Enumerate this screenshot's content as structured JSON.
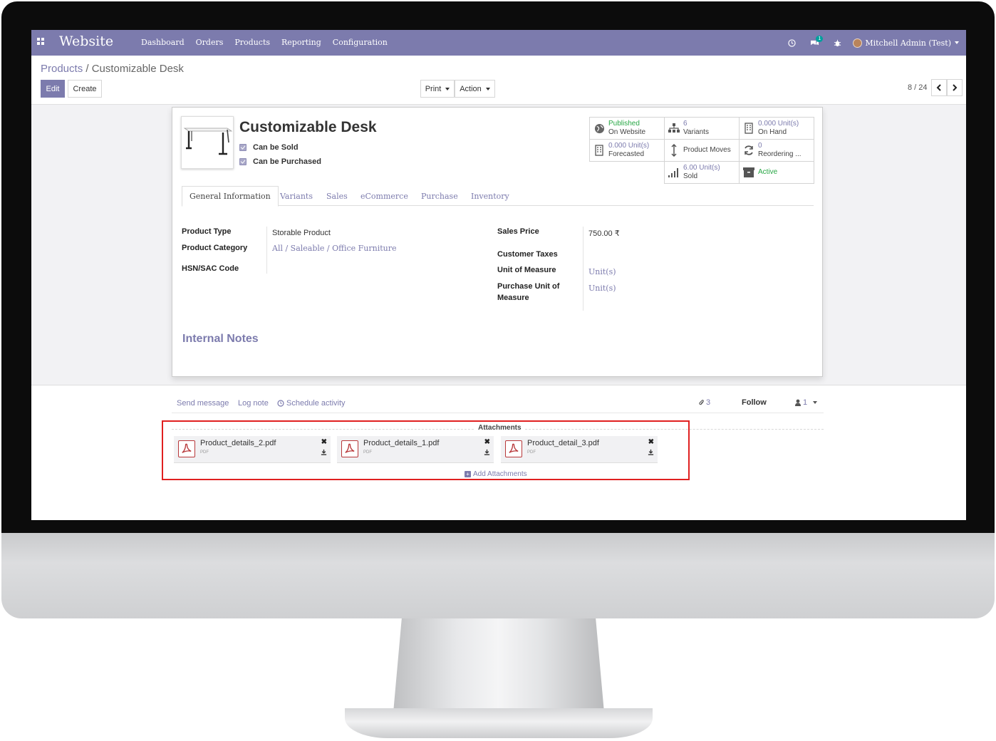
{
  "navbar": {
    "app_title": "Website",
    "menu": [
      "Dashboard",
      "Orders",
      "Products",
      "Reporting",
      "Configuration"
    ],
    "chat_badge": "1",
    "user_name": "Mitchell Admin (Test)"
  },
  "breadcrumb": {
    "parent": "Products",
    "separator": " / ",
    "current": "Customizable Desk"
  },
  "buttons": {
    "edit": "Edit",
    "create": "Create",
    "print": "Print",
    "action": "Action"
  },
  "pager": {
    "text": "8 / 24"
  },
  "product": {
    "name": "Customizable Desk",
    "can_be_sold": "Can be Sold",
    "can_be_purchased": "Can be Purchased"
  },
  "smart_buttons": {
    "published": {
      "line1": "Published",
      "line2": "On Website"
    },
    "variants": {
      "line1": "6",
      "line2": "Variants"
    },
    "on_hand": {
      "line1": "0.000 Unit(s)",
      "line2": "On Hand"
    },
    "forecasted": {
      "line1": "0.000 Unit(s)",
      "line2": "Forecasted"
    },
    "product_moves": {
      "line1": "Product Moves"
    },
    "reordering": {
      "line1": "0",
      "line2": "Reordering ..."
    },
    "sold": {
      "line1": "6.00 Unit(s)",
      "line2": "Sold"
    },
    "active": {
      "line1": "Active"
    }
  },
  "tabs": [
    "General Information",
    "Variants",
    "Sales",
    "eCommerce",
    "Purchase",
    "Inventory"
  ],
  "general_info": {
    "product_type_label": "Product Type",
    "product_type_value": "Storable Product",
    "product_category_label": "Product Category",
    "product_category_value": "All / Saleable / Office Furniture",
    "hsn_label": "HSN/SAC Code",
    "sales_price_label": "Sales Price",
    "sales_price_value": "750.00 ₹",
    "customer_taxes_label": "Customer Taxes",
    "uom_label": "Unit of Measure",
    "uom_value": "Unit(s)",
    "purchase_uom_label_1": "Purchase Unit of",
    "purchase_uom_label_2": "Measure",
    "purchase_uom_value": "Unit(s)"
  },
  "internal_notes": {
    "title": "Internal Notes"
  },
  "chatter": {
    "send_message": "Send message",
    "log_note": "Log note",
    "schedule_activity": "Schedule activity",
    "attachment_count": "3",
    "follow": "Follow",
    "follower_count": "1"
  },
  "attachments": {
    "title": "Attachments",
    "items": [
      {
        "name": "Product_details_2.pdf",
        "type": "PDF"
      },
      {
        "name": "Product_details_1.pdf",
        "type": "PDF"
      },
      {
        "name": "Product_detail_3.pdf",
        "type": "PDF"
      }
    ],
    "add_label": "Add Attachments"
  },
  "colors": {
    "brand": "#7c7bad",
    "highlight": "#e02020",
    "pdf_red": "#b8383a",
    "active_green": "#28a745"
  }
}
